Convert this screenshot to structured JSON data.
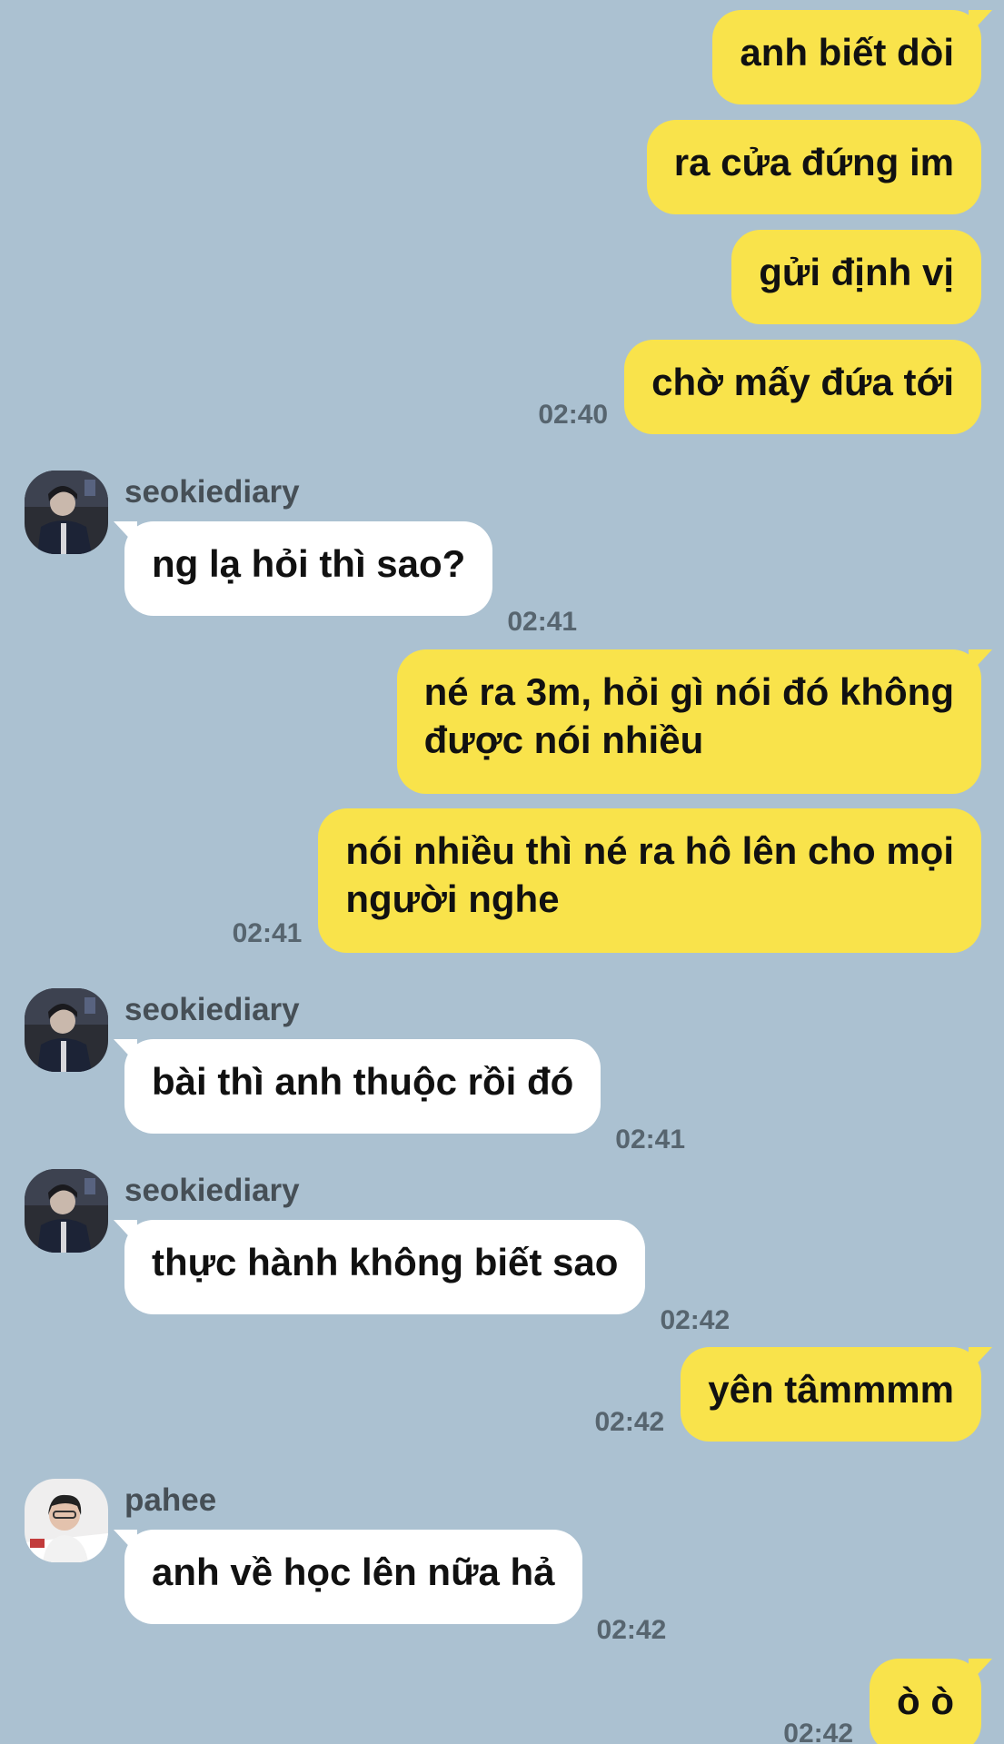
{
  "chat": {
    "messages": [
      {
        "text": "anh biết dòi"
      },
      {
        "text": "ra cửa đứng im"
      },
      {
        "text": "gửi định vị"
      },
      {
        "text": "chờ mấy đứa tới",
        "time": "02:40"
      },
      {
        "sender": "seokiediary",
        "text": "ng lạ hỏi thì sao?",
        "time": "02:41"
      },
      {
        "text": "né ra 3m, hỏi gì nói đó không\nđược nói nhiều"
      },
      {
        "text": "nói nhiều thì né ra hô lên cho mọi\nngười nghe",
        "time": "02:41"
      },
      {
        "sender": "seokiediary",
        "text": "bài thì anh thuộc rồi đó",
        "time": "02:41"
      },
      {
        "sender": "seokiediary",
        "text": "thực hành không biết sao",
        "time": "02:42"
      },
      {
        "text": "yên tâmmmm",
        "time": "02:42"
      },
      {
        "sender": "pahee",
        "text": "anh về học lên nữa hả",
        "time": "02:42"
      },
      {
        "text": "ò ò",
        "time": "02:42"
      }
    ]
  },
  "colors": {
    "background": "#abc1d1",
    "outgoing_bubble": "#f9e34b",
    "incoming_bubble": "#ffffff",
    "timestamp": "#57656f",
    "sender_name": "#464f56"
  },
  "icons": {
    "avatar_seokiediary": "profile-photo",
    "avatar_pahee": "profile-photo"
  }
}
